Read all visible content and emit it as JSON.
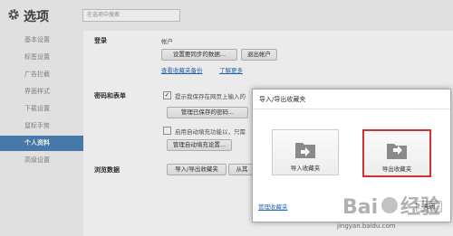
{
  "app": {
    "title": "选项",
    "search_placeholder": "在选项中搜索"
  },
  "sidebar": {
    "items": [
      {
        "label": "基本设置"
      },
      {
        "label": "标签设置"
      },
      {
        "label": "广告拦截"
      },
      {
        "label": "界面样式"
      },
      {
        "label": "下载设置"
      },
      {
        "label": "鼠标手势"
      },
      {
        "label": "个人资料"
      },
      {
        "label": "高级设置"
      }
    ],
    "active_index": 6
  },
  "login": {
    "label": "登录",
    "account_label": "帐户",
    "sync_button": "设置要同步的数据...",
    "logout_button": "退出帐户",
    "backup_link": "查看收藏夹备份",
    "learn_more_link": "了解更多"
  },
  "passwords": {
    "label": "密码和表单",
    "save_prompt": "提示我保存在网页上输入的",
    "save_prompt_checked": true,
    "manage_passwords_button": "管理已保存的密码...",
    "autofill_text": "启用自动填充功能以，只需",
    "autofill_checked": false,
    "autofill_settings_button": "管理自动填充设置..."
  },
  "browsing": {
    "label": "浏览数据",
    "import_export_button": "导入/导出收藏夹",
    "other_button": "从其"
  },
  "dialog": {
    "title": "导入/导出收藏夹",
    "import_label": "导入收藏夹",
    "export_label": "导出收藏夹",
    "manage_link": "管理收藏夹",
    "close_button": "关闭"
  },
  "watermark": {
    "url": "jingyan.baidu.com"
  },
  "colors": {
    "accent": "#4d83b8",
    "highlight": "#d43030",
    "link": "#2a6ab8"
  }
}
